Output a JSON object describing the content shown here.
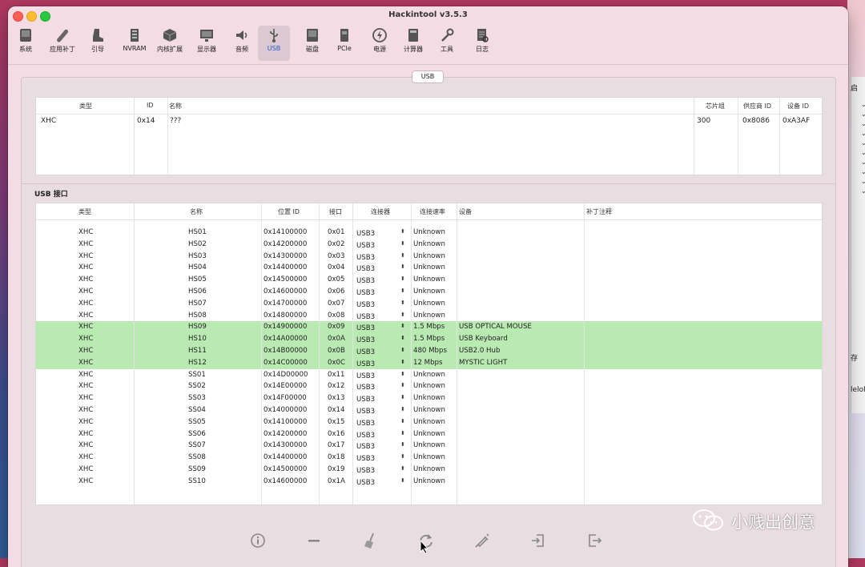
{
  "window": {
    "title": "Hackintool v3.5.3"
  },
  "toolbar": {
    "items": [
      {
        "label": "系统",
        "icon": "system-icon"
      },
      {
        "label": "应用补丁",
        "icon": "patch-icon"
      },
      {
        "label": "引导",
        "icon": "boot-icon"
      },
      {
        "label": "NVRAM",
        "icon": "nvram-icon"
      },
      {
        "label": "内核扩展",
        "icon": "kext-icon"
      },
      {
        "label": "显示器",
        "icon": "display-icon"
      },
      {
        "label": "音频",
        "icon": "audio-icon"
      },
      {
        "label": "USB",
        "icon": "usb-icon",
        "active": true
      },
      {
        "label": "磁盘",
        "icon": "disk-icon"
      },
      {
        "label": "PCIe",
        "icon": "pcie-icon"
      },
      {
        "label": "电源",
        "icon": "power-icon"
      },
      {
        "label": "计算器",
        "icon": "calculator-icon"
      },
      {
        "label": "工具",
        "icon": "tools-icon"
      },
      {
        "label": "日志",
        "icon": "log-icon"
      }
    ]
  },
  "tab": {
    "label": "USB"
  },
  "controllers": {
    "columns": [
      "类型",
      "ID",
      "名称",
      "芯片组",
      "供应商 ID",
      "设备 ID"
    ],
    "rows": [
      [
        "XHC",
        "0x14",
        "???",
        "300",
        "0x8086",
        "0xA3AF"
      ]
    ]
  },
  "ports_section": {
    "label": "USB 接口"
  },
  "ports": {
    "columns": [
      "类型",
      "名称",
      "位置 ID",
      "接口",
      "连接器",
      "连接速率",
      "设备",
      "补丁注释"
    ],
    "rows": [
      {
        "type": "XHC",
        "name": "HS01",
        "loc": "0x14100000",
        "port": "0x01",
        "conn": "USB3",
        "speed": "Unknown",
        "device": "",
        "note": "",
        "active": false
      },
      {
        "type": "XHC",
        "name": "HS02",
        "loc": "0x14200000",
        "port": "0x02",
        "conn": "USB3",
        "speed": "Unknown",
        "device": "",
        "note": "",
        "active": false
      },
      {
        "type": "XHC",
        "name": "HS03",
        "loc": "0x14300000",
        "port": "0x03",
        "conn": "USB3",
        "speed": "Unknown",
        "device": "",
        "note": "",
        "active": false
      },
      {
        "type": "XHC",
        "name": "HS04",
        "loc": "0x14400000",
        "port": "0x04",
        "conn": "USB3",
        "speed": "Unknown",
        "device": "",
        "note": "",
        "active": false
      },
      {
        "type": "XHC",
        "name": "HS05",
        "loc": "0x14500000",
        "port": "0x05",
        "conn": "USB3",
        "speed": "Unknown",
        "device": "",
        "note": "",
        "active": false
      },
      {
        "type": "XHC",
        "name": "HS06",
        "loc": "0x14600000",
        "port": "0x06",
        "conn": "USB3",
        "speed": "Unknown",
        "device": "",
        "note": "",
        "active": false
      },
      {
        "type": "XHC",
        "name": "HS07",
        "loc": "0x14700000",
        "port": "0x07",
        "conn": "USB3",
        "speed": "Unknown",
        "device": "",
        "note": "",
        "active": false
      },
      {
        "type": "XHC",
        "name": "HS08",
        "loc": "0x14800000",
        "port": "0x08",
        "conn": "USB3",
        "speed": "Unknown",
        "device": "",
        "note": "",
        "active": false
      },
      {
        "type": "XHC",
        "name": "HS09",
        "loc": "0x14900000",
        "port": "0x09",
        "conn": "USB3",
        "speed": "1.5 Mbps",
        "device": "USB OPTICAL MOUSE",
        "note": "",
        "active": true
      },
      {
        "type": "XHC",
        "name": "HS10",
        "loc": "0x14A00000",
        "port": "0x0A",
        "conn": "USB3",
        "speed": "1.5 Mbps",
        "device": "USB Keyboard",
        "note": "",
        "active": true
      },
      {
        "type": "XHC",
        "name": "HS11",
        "loc": "0x14B00000",
        "port": "0x0B",
        "conn": "USB3",
        "speed": "480 Mbps",
        "device": "USB2.0 Hub",
        "note": "",
        "active": true
      },
      {
        "type": "XHC",
        "name": "HS12",
        "loc": "0x14C00000",
        "port": "0x0C",
        "conn": "USB3",
        "speed": "12 Mbps",
        "device": "MYSTIC LIGHT",
        "note": "",
        "active": true
      },
      {
        "type": "XHC",
        "name": "SS01",
        "loc": "0x14D00000",
        "port": "0x11",
        "conn": "USB3",
        "speed": "Unknown",
        "device": "",
        "note": "",
        "active": false
      },
      {
        "type": "XHC",
        "name": "SS02",
        "loc": "0x14E00000",
        "port": "0x12",
        "conn": "USB3",
        "speed": "Unknown",
        "device": "",
        "note": "",
        "active": false
      },
      {
        "type": "XHC",
        "name": "SS03",
        "loc": "0x14F00000",
        "port": "0x13",
        "conn": "USB3",
        "speed": "Unknown",
        "device": "",
        "note": "",
        "active": false
      },
      {
        "type": "XHC",
        "name": "SS04",
        "loc": "0x14000000",
        "port": "0x14",
        "conn": "USB3",
        "speed": "Unknown",
        "device": "",
        "note": "",
        "active": false
      },
      {
        "type": "XHC",
        "name": "SS05",
        "loc": "0x14100000",
        "port": "0x15",
        "conn": "USB3",
        "speed": "Unknown",
        "device": "",
        "note": "",
        "active": false
      },
      {
        "type": "XHC",
        "name": "SS06",
        "loc": "0x14200000",
        "port": "0x16",
        "conn": "USB3",
        "speed": "Unknown",
        "device": "",
        "note": "",
        "active": false
      },
      {
        "type": "XHC",
        "name": "SS07",
        "loc": "0x14300000",
        "port": "0x17",
        "conn": "USB3",
        "speed": "Unknown",
        "device": "",
        "note": "",
        "active": false
      },
      {
        "type": "XHC",
        "name": "SS08",
        "loc": "0x14400000",
        "port": "0x18",
        "conn": "USB3",
        "speed": "Unknown",
        "device": "",
        "note": "",
        "active": false
      },
      {
        "type": "XHC",
        "name": "SS09",
        "loc": "0x14500000",
        "port": "0x19",
        "conn": "USB3",
        "speed": "Unknown",
        "device": "",
        "note": "",
        "active": false
      },
      {
        "type": "XHC",
        "name": "SS10",
        "loc": "0x14600000",
        "port": "0x1A",
        "conn": "USB3",
        "speed": "Unknown",
        "device": "",
        "note": "",
        "active": false
      }
    ]
  },
  "bottom_toolbar": {
    "icons": [
      "info-icon",
      "remove-icon",
      "clean-broom-icon",
      "refresh-icon",
      "inject-syringe-icon",
      "import-icon",
      "export-icon"
    ]
  },
  "background_window": {
    "fragments": [
      "启",
      "存",
      "leloM"
    ]
  },
  "watermark": {
    "text": "小贱出创意",
    "icon": "wechat-icon"
  },
  "colors": {
    "active_row": "#b9eab2",
    "window_bg": "#f3dce3",
    "selected_tab": "#1a5fd6"
  }
}
